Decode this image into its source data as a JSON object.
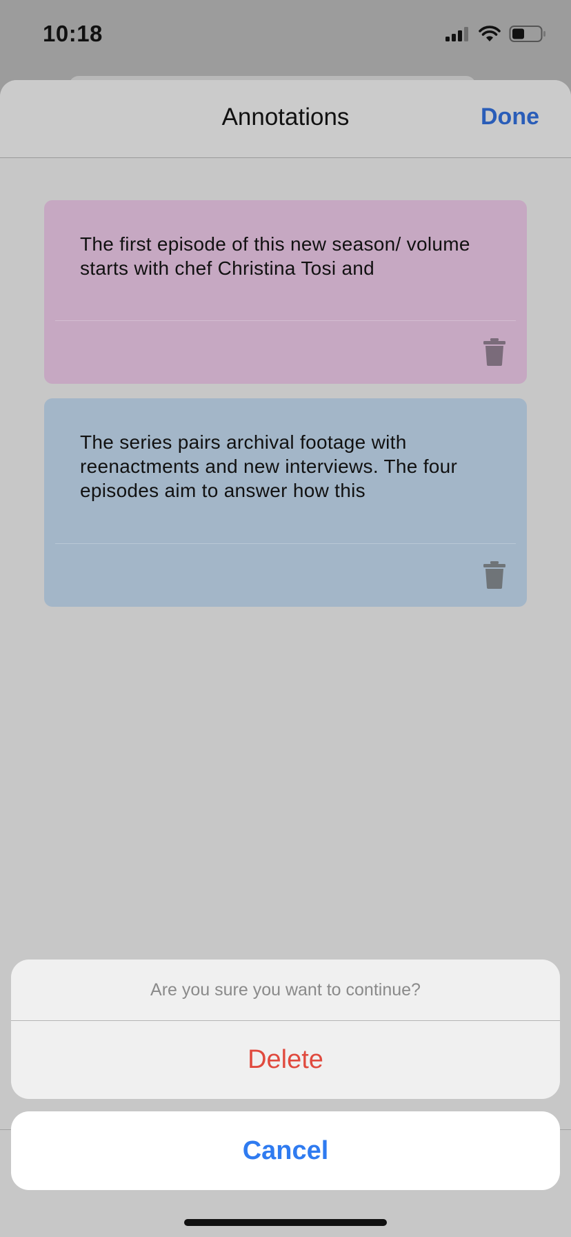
{
  "status_bar": {
    "time": "10:18",
    "icons": [
      "signal-icon",
      "wifi-icon",
      "battery-icon"
    ]
  },
  "sheet": {
    "title": "Annotations",
    "done_label": "Done"
  },
  "annotations": [
    {
      "text": " The first episode of this new season/ volume starts with chef Christina Tosi and",
      "color": "#c6a8c2"
    },
    {
      "text": "The series pairs archival footage with reenactments and new interviews. The four episodes aim to answer how this",
      "color": "#a3b6c8"
    }
  ],
  "action_sheet": {
    "message": "Are you sure you want to continue?",
    "delete_label": "Delete",
    "cancel_label": "Cancel"
  },
  "colors": {
    "accent": "#2a5db8",
    "destructive": "#e04a3e",
    "cancel": "#2f7bf0"
  }
}
